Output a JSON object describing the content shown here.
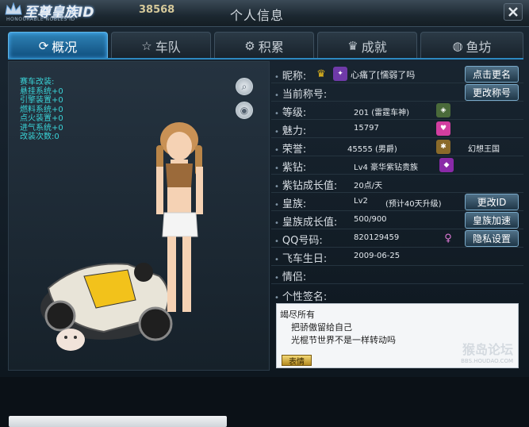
{
  "brand": {
    "name": "至尊皇族ID",
    "subtitle": "HONOURABLE NOBLES ID"
  },
  "score": "38568",
  "window_title": "个人信息",
  "tabs": [
    {
      "label": "概况",
      "icon": "refresh-icon",
      "active": true
    },
    {
      "label": "车队",
      "icon": "star-icon",
      "active": false
    },
    {
      "label": "积累",
      "icon": "gear-icon",
      "active": false
    },
    {
      "label": "成就",
      "icon": "trophy-icon",
      "active": false
    },
    {
      "label": "鱼坊",
      "icon": "fish-bowl-icon",
      "active": false
    }
  ],
  "stats": [
    "赛车改装:",
    "悬挂系统+0",
    "引擎装置+0",
    "燃料系统+0",
    "点火装置+0",
    "进气系统+0",
    "改装次数:0"
  ],
  "profile": {
    "nickname_label": "昵称:",
    "nickname": "心痛了[懦弱了吗",
    "rename_button": "点击更名",
    "title_label": "当前称号:",
    "change_title_button": "更改称号",
    "level_label": "等级:",
    "level_value": "201 (雷霆车神)",
    "charm_label": "魅力:",
    "charm_value": "15797",
    "honor_label": "荣誉:",
    "honor_value": "45555 (男爵)",
    "honor_extra": "幻想王国",
    "purple_label": "紫钻:",
    "purple_value": "Lv4  豪华紫钻贵族",
    "purple_growth_label": "紫钻成长值:",
    "purple_growth_value": "20点/天",
    "noble_label": "皇族:",
    "noble_level": "Lv2",
    "noble_note": "(预计40天升级)",
    "change_id_button": "更改ID",
    "noble_growth_label": "皇族成长值:",
    "noble_growth_value": "500/900",
    "noble_speed_button": "皇族加速",
    "qq_label": "QQ号码:",
    "qq_value": "820129459",
    "privacy_button": "隐私设置",
    "birthday_label": "飞车生日:",
    "birthday_value": "2009-06-25",
    "partner_label": "情侣:",
    "signature_label": "个性签名:",
    "signature_lines": [
      "竭尽所有",
      "把骄傲留给自己",
      "光棍节世界不是一样转动吗"
    ],
    "mood_button": "表情"
  },
  "watermark": {
    "line1": "猴岛论坛",
    "line2": "BBS.HOUDAO.COM"
  },
  "colors": {
    "accent": "#2f84b8",
    "nickname": "#d25ee0",
    "stats": "#3ad3d7"
  }
}
